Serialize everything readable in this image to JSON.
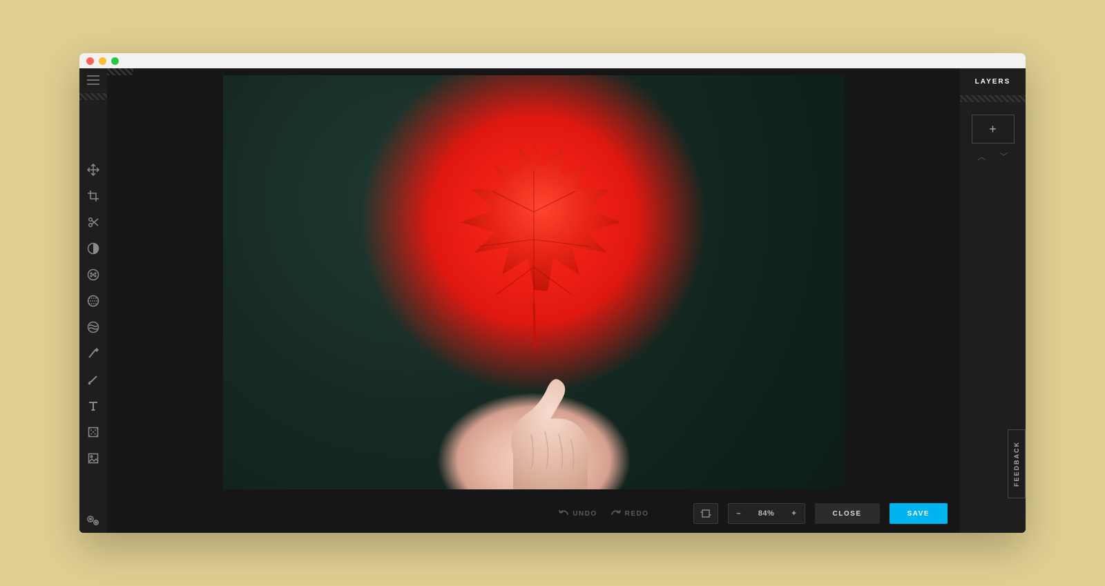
{
  "right_panel": {
    "title": "LAYERS",
    "add": "+",
    "feedback": "FEEDBACK"
  },
  "actions": {
    "undo": "UNDO",
    "redo": "REDO",
    "zoom": "84%",
    "zoom_minus": "–",
    "zoom_plus": "+",
    "close": "CLOSE",
    "save": "SAVE"
  },
  "image": {
    "subject": "red maple leaf held by hand",
    "background": "dark green bokeh foliage"
  },
  "tools": [
    "move",
    "crop",
    "cut",
    "adjust",
    "effects",
    "filters",
    "liquify",
    "retouch",
    "draw",
    "text",
    "elements",
    "frames"
  ]
}
